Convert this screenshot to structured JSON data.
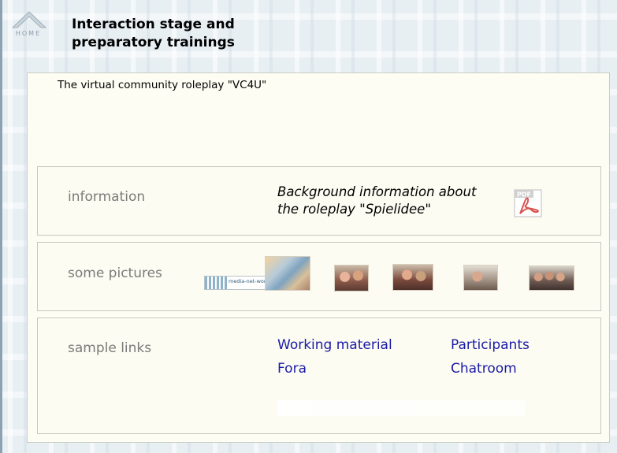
{
  "nav": {
    "home_label": "HOME"
  },
  "header": {
    "title_line1": "Interaction stage and",
    "title_line2": "preparatory trainings"
  },
  "main": {
    "subtitle": "The virtual community roleplay \"VC4U\"",
    "info": {
      "label": "information",
      "link_line1": "Background information about",
      "link_line2": "the roleplay \"Spielidee\"",
      "pdf_icon_text": "PDF"
    },
    "pictures": {
      "label": "some pictures",
      "logo_text": "media-net-works"
    },
    "links": {
      "label": "sample links",
      "items": [
        "Working material",
        "Participants",
        "Fora",
        "Chatroom"
      ]
    }
  },
  "colors": {
    "link": "#1a1aa6",
    "section_label": "#7b7b7b",
    "panel_bg": "#fdfdf3",
    "border": "#c7c7c0"
  }
}
